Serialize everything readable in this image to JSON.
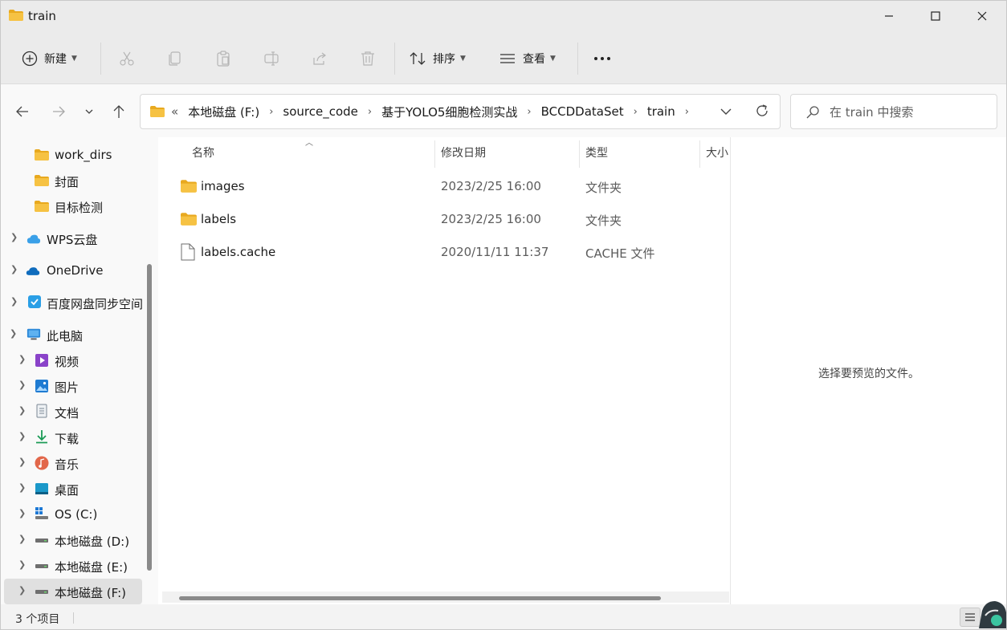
{
  "window": {
    "title": "train"
  },
  "toolbar": {
    "new_label": "新建",
    "sort_label": "排序",
    "view_label": "查看",
    "more_icon": "ellipsis-icon"
  },
  "address": {
    "overflow": "«",
    "crumbs": [
      "本地磁盘 (F:)",
      "source_code",
      "基于YOLO5细胞检测实战",
      "BCCDDataSet",
      "train"
    ]
  },
  "search": {
    "placeholder": "在 train 中搜索"
  },
  "sidebar": {
    "items": [
      {
        "label": "work_dirs"
      },
      {
        "label": "封面"
      },
      {
        "label": "目标检测"
      },
      {
        "label": "WPS云盘"
      },
      {
        "label": "OneDrive"
      },
      {
        "label": "百度网盘同步空间"
      },
      {
        "label": "此电脑"
      },
      {
        "label": "视频"
      },
      {
        "label": "图片"
      },
      {
        "label": "文档"
      },
      {
        "label": "下载"
      },
      {
        "label": "音乐"
      },
      {
        "label": "桌面"
      },
      {
        "label": "OS (C:)"
      },
      {
        "label": "本地磁盘 (D:)"
      },
      {
        "label": "本地磁盘 (E:)"
      },
      {
        "label": "本地磁盘 (F:)"
      }
    ]
  },
  "columns": {
    "name": "名称",
    "modified": "修改日期",
    "type": "类型",
    "size": "大小"
  },
  "files": [
    {
      "name": "images",
      "modified": "2023/2/25 16:00",
      "type": "文件夹"
    },
    {
      "name": "labels",
      "modified": "2023/2/25 16:00",
      "type": "文件夹"
    },
    {
      "name": "labels.cache",
      "modified": "2020/11/11 11:37",
      "type": "CACHE 文件"
    }
  ],
  "preview": {
    "message": "选择要预览的文件。"
  },
  "status": {
    "count": "3 个项目"
  },
  "colors": {
    "folder": "#f6c243",
    "folder_dark": "#e8a91f",
    "accent": "#0067c0"
  }
}
